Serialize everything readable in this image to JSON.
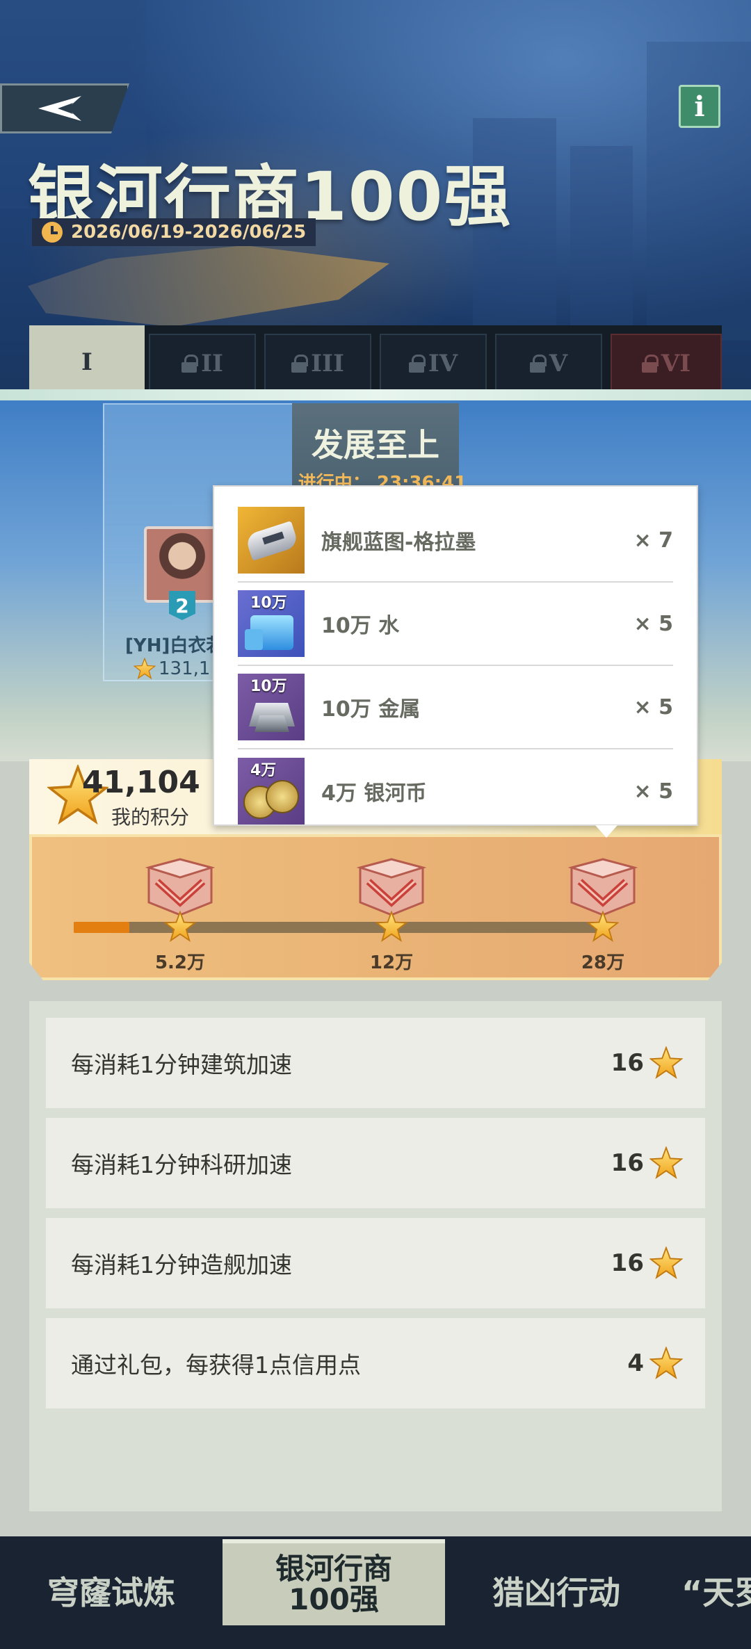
{
  "header": {
    "title": "银河行商100强",
    "date_range": "2026/06/19-2026/06/25"
  },
  "tabs": [
    {
      "label": "I",
      "locked": false
    },
    {
      "label": "II",
      "locked": true
    },
    {
      "label": "III",
      "locked": true
    },
    {
      "label": "IV",
      "locked": true
    },
    {
      "label": "V",
      "locked": true
    },
    {
      "label": "VI",
      "locked": true
    }
  ],
  "stage": {
    "name": "发展至上",
    "status": "进行中：  23:36:41"
  },
  "top_player": {
    "rank": "2",
    "name": "[YH]白衣若",
    "score": "131,1"
  },
  "reward_popup": {
    "items": [
      {
        "icon": "blueprint-icon",
        "tag": "",
        "name": "旗舰蓝图-格拉墨",
        "qty": "× 7"
      },
      {
        "icon": "water-icon",
        "tag": "10万",
        "name": "10万 水",
        "qty": "× 5"
      },
      {
        "icon": "metal-icon",
        "tag": "10万",
        "name": "10万 金属",
        "qty": "× 5"
      },
      {
        "icon": "galaxy-coin-icon",
        "tag": "4万",
        "name": "4万 银河币",
        "qty": "× 5"
      }
    ]
  },
  "my_score": {
    "value": "41,104",
    "label": "我的积分"
  },
  "milestones": {
    "progress_fraction": 0.105,
    "items": [
      {
        "label": "5.2万"
      },
      {
        "label": "12万"
      },
      {
        "label": "28万"
      }
    ]
  },
  "tasks": [
    {
      "text": "每消耗1分钟建筑加速",
      "points": "16"
    },
    {
      "text": "每消耗1分钟科研加速",
      "points": "16"
    },
    {
      "text": "每消耗1分钟造舰加速",
      "points": "16"
    },
    {
      "text": "通过礼包，每获得1点信用点",
      "points": "4"
    }
  ],
  "bottom_nav": [
    {
      "label": "穹窿试炼",
      "active": false
    },
    {
      "label": "银河行商\n100强",
      "active": true
    },
    {
      "label": "猎凶行动",
      "active": false
    },
    {
      "label": "“天罗",
      "active": false
    }
  ],
  "colors": {
    "accent_gold": "#f2b64f",
    "progress_orange": "#e37f10",
    "tab_active": "#c7ccbb"
  }
}
